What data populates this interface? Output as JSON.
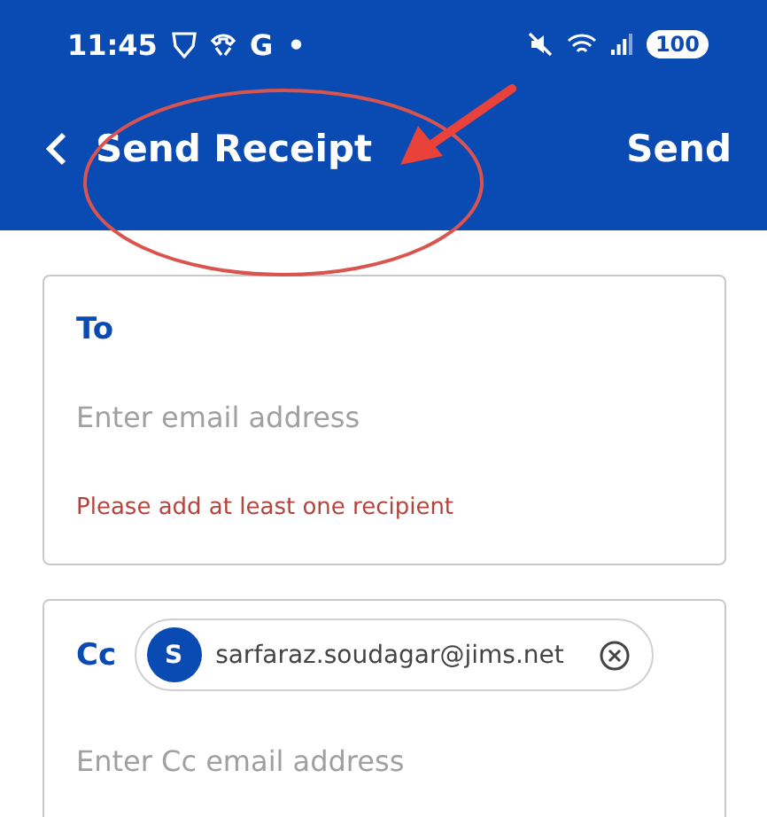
{
  "status_bar": {
    "time": "11:45",
    "letter": "G",
    "dot": "•",
    "battery": "100"
  },
  "app_bar": {
    "title": "Send Receipt",
    "action": "Send"
  },
  "to_field": {
    "label": "To",
    "placeholder": "Enter email address",
    "error": "Please add at least one recipient"
  },
  "cc_field": {
    "label": "Cc",
    "chips": [
      {
        "initial": "S",
        "email": "sarfaraz.soudagar@jims.net"
      }
    ],
    "placeholder": "Enter Cc email address"
  }
}
